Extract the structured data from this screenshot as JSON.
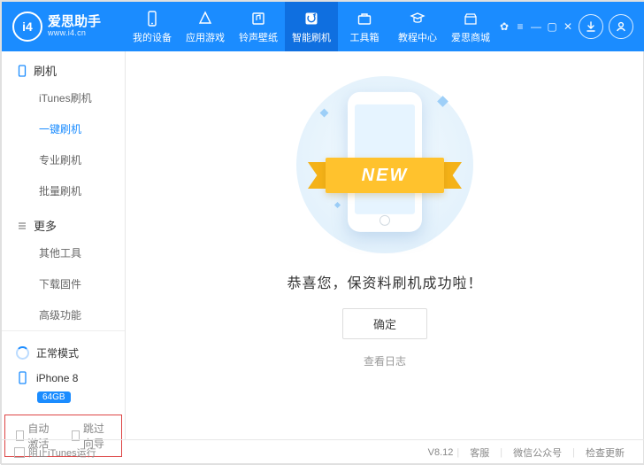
{
  "brand": {
    "cn": "爱思助手",
    "url": "www.i4.cn",
    "logo_text": "i4"
  },
  "top_tabs": [
    {
      "label": "我的设备",
      "icon": "device-icon"
    },
    {
      "label": "应用游戏",
      "icon": "apps-icon"
    },
    {
      "label": "铃声壁纸",
      "icon": "ringtone-icon"
    },
    {
      "label": "智能刷机",
      "icon": "flash-icon",
      "active": true
    },
    {
      "label": "工具箱",
      "icon": "toolbox-icon"
    },
    {
      "label": "教程中心",
      "icon": "tutorial-icon"
    },
    {
      "label": "爱思商城",
      "icon": "store-icon"
    }
  ],
  "sidebar": {
    "groups": [
      {
        "title": "刷机",
        "icon": "phone-icon",
        "items": [
          {
            "label": "iTunes刷机"
          },
          {
            "label": "一键刷机",
            "active": true
          },
          {
            "label": "专业刷机"
          },
          {
            "label": "批量刷机"
          }
        ]
      },
      {
        "title": "更多",
        "icon": "more-icon",
        "items": [
          {
            "label": "其他工具"
          },
          {
            "label": "下载固件"
          },
          {
            "label": "高级功能"
          }
        ]
      }
    ],
    "mode_label": "正常模式",
    "device_name": "iPhone 8",
    "device_capacity": "64GB",
    "checks": [
      {
        "label": "自动激活"
      },
      {
        "label": "跳过向导"
      }
    ]
  },
  "main": {
    "ribbon_text": "NEW",
    "success_text": "恭喜您，保资料刷机成功啦！",
    "confirm_label": "确定",
    "log_label": "查看日志"
  },
  "footer": {
    "block_itunes": "阻止iTunes运行",
    "version": "V8.12",
    "links": [
      "客服",
      "微信公众号",
      "检查更新"
    ]
  }
}
